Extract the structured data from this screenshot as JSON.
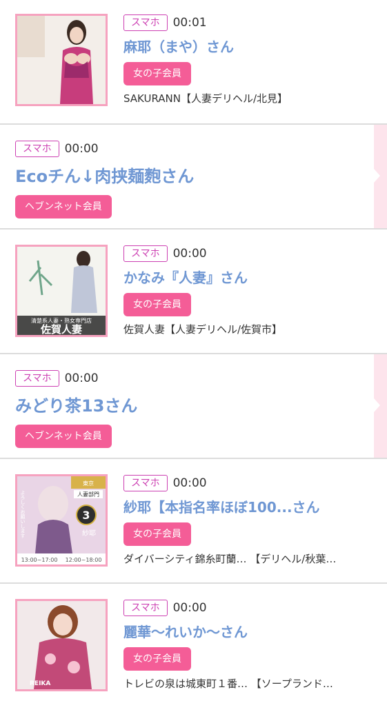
{
  "entries": [
    {
      "badge": "スマホ",
      "time": "00:01",
      "name": "麻耶（まや）さん",
      "member": "女の子会員",
      "shop": "SAKURANN【人妻デリヘル/北見】"
    },
    {
      "badge": "スマホ",
      "time": "00:00",
      "name": "Ecoチん↓肉挟麺麭さん",
      "member": "ヘブンネット会員"
    },
    {
      "badge": "スマホ",
      "time": "00:00",
      "name": "かなみ『人妻』さん",
      "member": "女の子会員",
      "shop": "佐賀人妻【人妻デリヘル/佐賀市】",
      "photo_caption": "清楚系人妻・熟女専門店",
      "photo_logo": "佐賀人妻"
    },
    {
      "badge": "スマホ",
      "time": "00:00",
      "name": "みどり茶13さん",
      "member": "ヘブンネット会員"
    },
    {
      "badge": "スマホ",
      "time": "00:00",
      "name": "紗耶【本指名率ほぼ100...さん",
      "member": "女の子会員",
      "shop": "ダイバーシティ錦糸町蘭…  【デリヘル/秋葉…",
      "photo_top": "東京",
      "photo_rank": "人妻部門",
      "photo_name": "紗耶",
      "photo_hours_left": "13:00~17:00",
      "photo_hours_right": "12:00~18:00",
      "photo_note": "よろしくお願いします"
    },
    {
      "badge": "スマホ",
      "time": "00:00",
      "name": "麗華〜れいか〜さん",
      "member": "女の子会員",
      "shop": "トレビの泉は城東町１番…   【ソープランド…",
      "photo_logo": "REIKA"
    }
  ]
}
